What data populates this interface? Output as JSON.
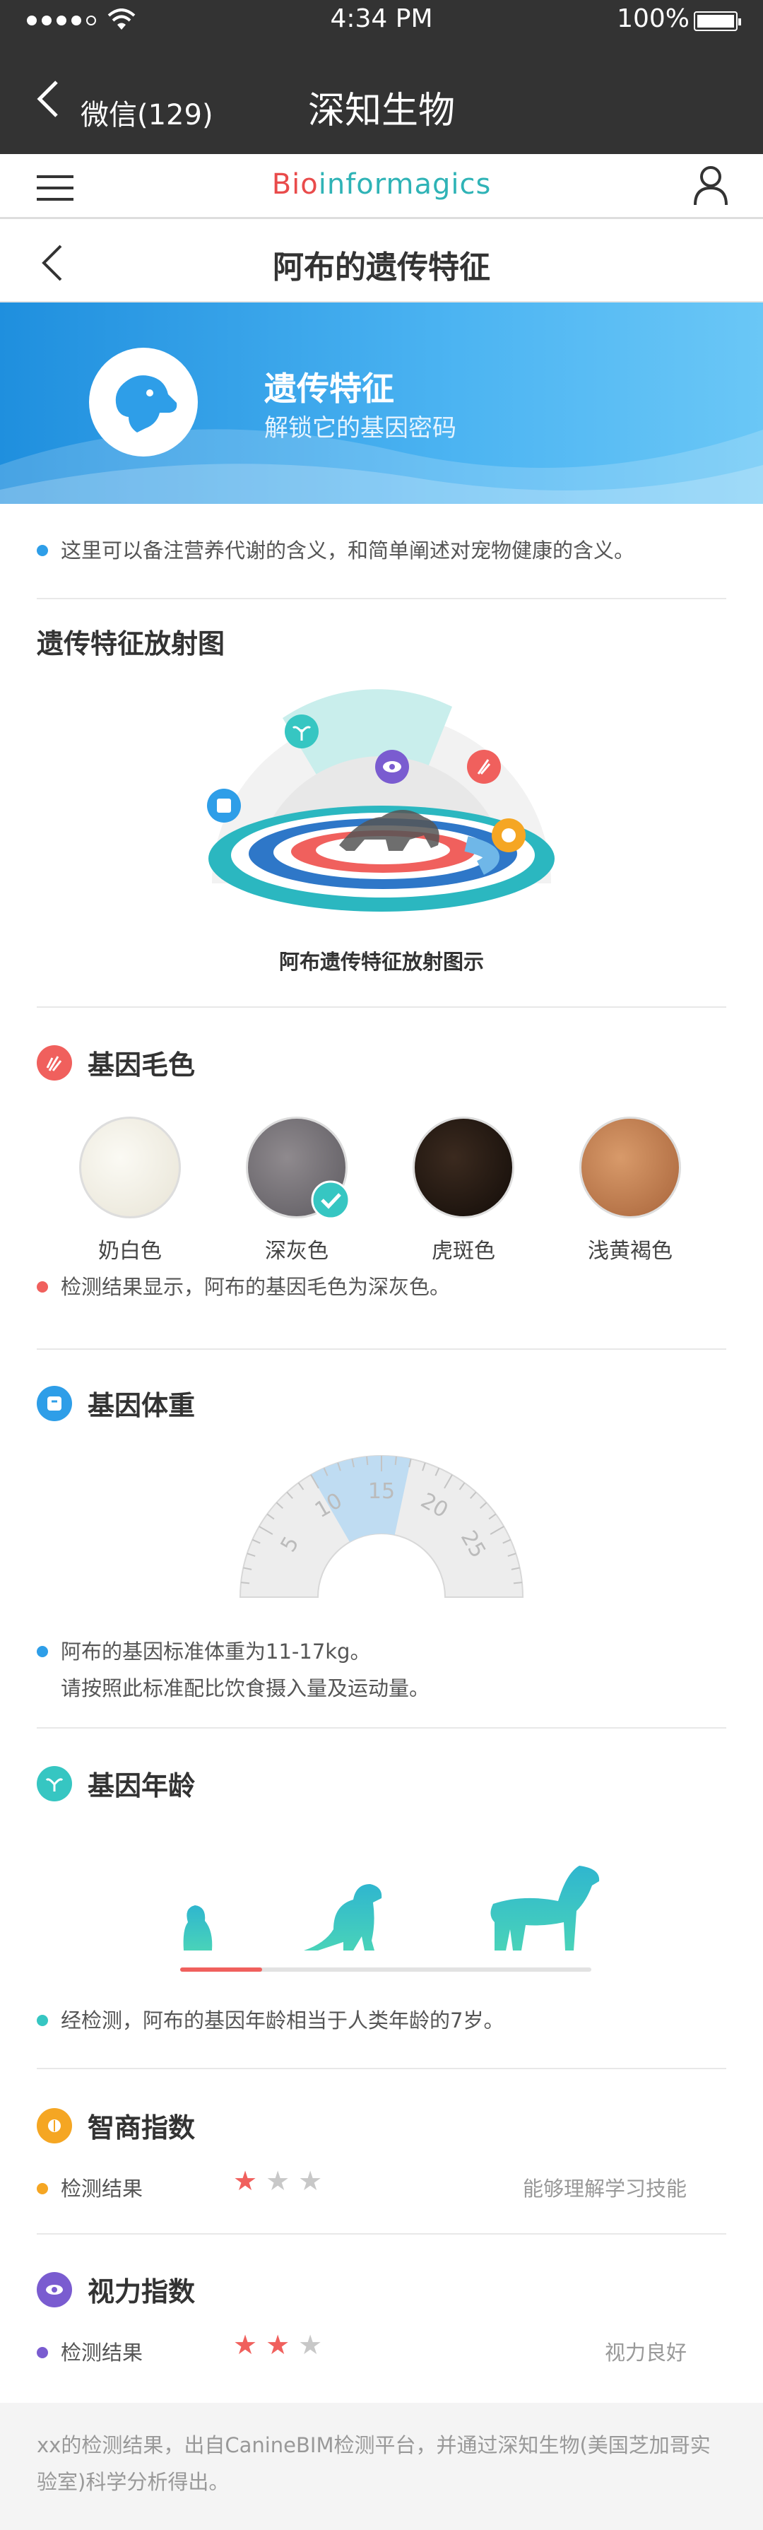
{
  "status_bar": {
    "time": "4:34 PM",
    "battery": "100%"
  },
  "nav": {
    "back_label": "微信(129)",
    "title": "深知生物"
  },
  "site": {
    "brand_prefix": "Bi",
    "brand_mid": "o",
    "brand_suffix": "informagics"
  },
  "page": {
    "title": "阿布的遗传特征"
  },
  "banner": {
    "title": "遗传特征",
    "subtitle": "解锁它的基因密码",
    "bg": "#2e9ee8"
  },
  "intro": {
    "text": "这里可以备注营养代谢的含义，和简单阐述对宠物健康的含义。"
  },
  "radar": {
    "heading": "遗传特征放射图",
    "caption": "阿布遗传特征放射图示"
  },
  "coat": {
    "heading": "基因毛色",
    "options": [
      {
        "label": "奶白色",
        "selected": false
      },
      {
        "label": "深灰色",
        "selected": true
      },
      {
        "label": "虎斑色",
        "selected": false
      },
      {
        "label": "浅黄褐色",
        "selected": false
      }
    ],
    "result": "检测结果显示，阿布的基因毛色为深灰色。"
  },
  "weight": {
    "heading": "基因体重",
    "ticks": [
      "5",
      "10",
      "15",
      "20",
      "25"
    ],
    "highlight_from": 10,
    "highlight_to": 17,
    "result_line1": "阿布的基因标准体重为11-17kg。",
    "result_line2": "请按照此标准配比饮食摄入量及运动量。"
  },
  "age": {
    "heading": "基因年龄",
    "progress": 0.2,
    "result": "经检测，阿布的基因年龄相当于人类年龄的7岁。"
  },
  "iq": {
    "heading": "智商指数",
    "label": "检测结果",
    "stars": 1,
    "max_stars": 3,
    "verdict": "能够理解学习技能"
  },
  "vision": {
    "heading": "视力指数",
    "label": "检测结果",
    "stars": 2,
    "max_stars": 3,
    "verdict": "视力良好"
  },
  "footer": {
    "text": "xx的检测结果，出自CanineBIM检测平台，并通过深知生物(美国芝加哥实验室)科学分析得出。"
  },
  "colors": {
    "accent_teal": "#36c6c2",
    "accent_red": "#f0605d",
    "accent_blue": "#2e9ee8",
    "accent_purple": "#7a5cd0",
    "accent_orange": "#f5a623"
  }
}
